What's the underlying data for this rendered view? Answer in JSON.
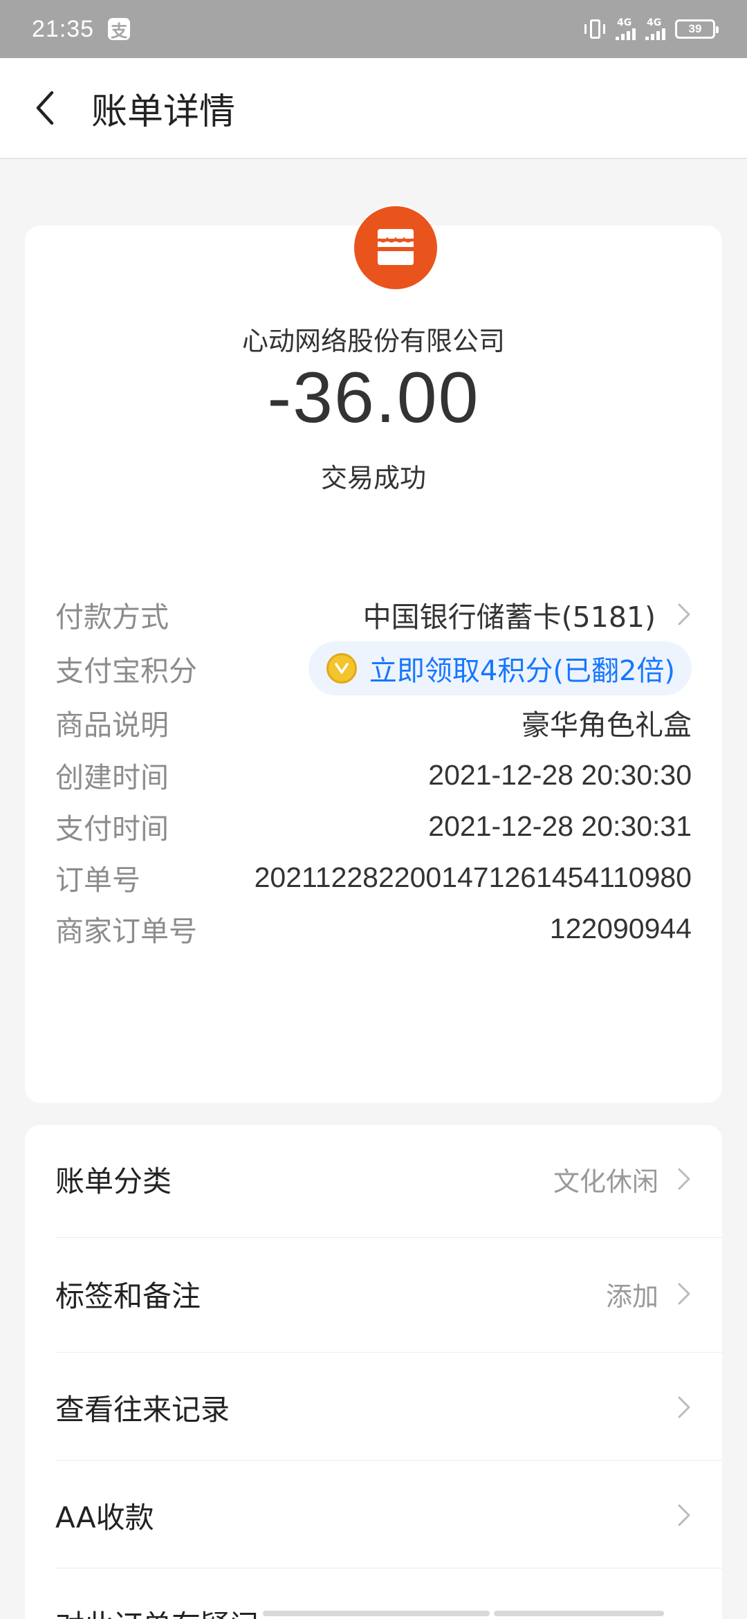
{
  "status_bar": {
    "time": "21:35",
    "app_icon_glyph": "支",
    "network_1": "4G",
    "network_2": "4G",
    "battery": "39"
  },
  "header": {
    "title": "账单详情"
  },
  "summary": {
    "merchant": "心动网络股份有限公司",
    "amount": "-36.00",
    "status": "交易成功",
    "logo_color": "#e9541d"
  },
  "details": [
    {
      "label": "付款方式",
      "value": "中国银行储蓄卡(5181)"
    },
    {
      "label": "支付宝积分",
      "value": "立即领取4积分(已翻2倍)"
    },
    {
      "label": "商品说明",
      "value": "豪华角色礼盒"
    },
    {
      "label": "创建时间",
      "value": "2021-12-28 20:30:30"
    },
    {
      "label": "支付时间",
      "value": "2021-12-28 20:30:31"
    },
    {
      "label": "订单号",
      "value": "2021122822001471261454110980"
    },
    {
      "label": "商家订单号",
      "value": "122090944"
    }
  ],
  "actions": [
    {
      "label": "账单分类",
      "value": "文化休闲"
    },
    {
      "label": "标签和备注",
      "value": "添加"
    },
    {
      "label": "查看往来记录",
      "value": ""
    },
    {
      "label": "AA收款",
      "value": ""
    },
    {
      "label": "对此订单有疑问",
      "value": ""
    }
  ],
  "colors": {
    "accent_blue": "#1677ff",
    "status_bar": "#a5a5a5",
    "coin": "#f3c42b"
  }
}
